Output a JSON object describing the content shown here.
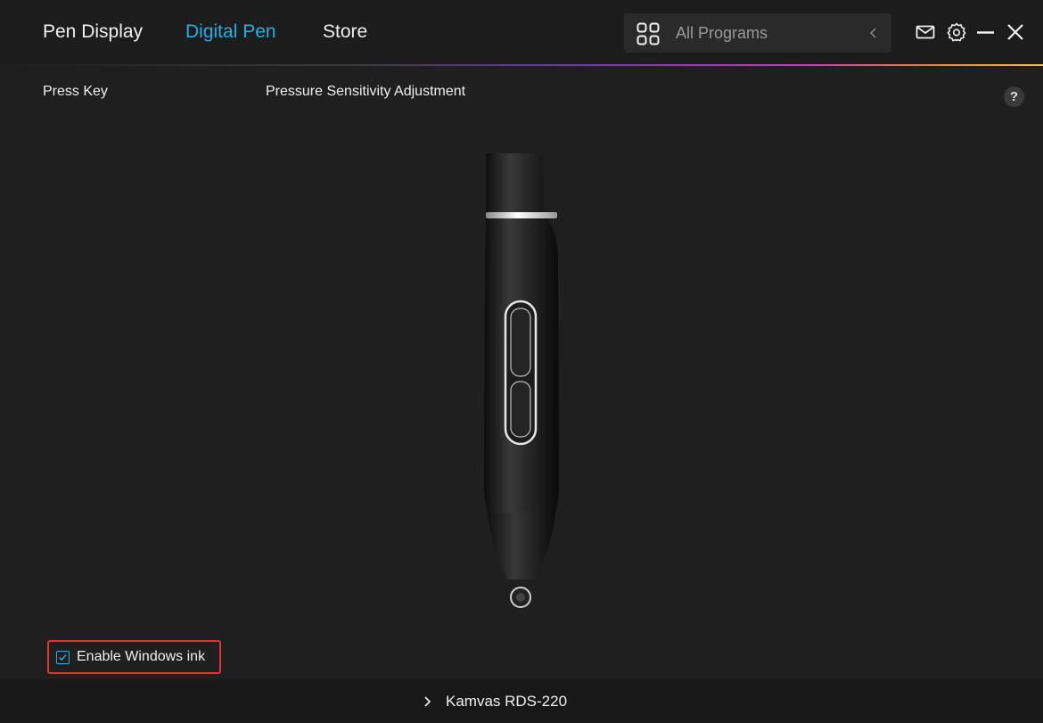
{
  "nav": {
    "tabs": [
      {
        "label": "Pen Display",
        "active": false
      },
      {
        "label": "Digital Pen",
        "active": true
      },
      {
        "label": "Store",
        "active": false
      }
    ]
  },
  "program_selector": {
    "label": "All Programs",
    "icon": "grid-icon"
  },
  "window_controls": {
    "icons": [
      "mail-icon",
      "gear-icon",
      "minimize-icon",
      "close-icon"
    ]
  },
  "subtabs": [
    {
      "label": "Press Key"
    },
    {
      "label": "Pressure Sensitivity Adjustment"
    }
  ],
  "help": {
    "label": "?"
  },
  "windows_ink": {
    "label": "Enable Windows ink",
    "checked": true
  },
  "footer": {
    "device_name": "Kamvas RDS-220"
  },
  "colors": {
    "accent": "#22b0e0",
    "background": "#1f1f1f",
    "highlight_box": "#e8332a"
  }
}
